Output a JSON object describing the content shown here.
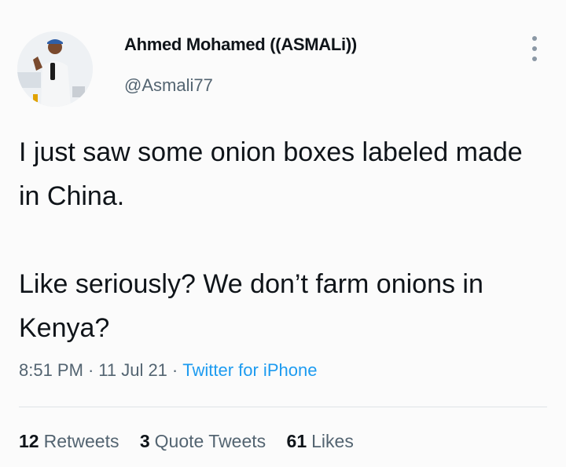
{
  "author": {
    "display_name": "Ahmed Mohamed ((ASMALi))",
    "handle": "@Asmali77"
  },
  "tweet": {
    "paragraph_1": "I just saw some onion boxes labeled made in China.",
    "paragraph_2": "Like seriously? We don’t farm onions in Kenya?"
  },
  "meta": {
    "time": "8:51 PM",
    "separator": "·",
    "date": "11 Jul 21",
    "source": "Twitter for iPhone"
  },
  "stats": {
    "retweets_count": "12",
    "retweets_label": "Retweets",
    "quote_count": "3",
    "quote_label": "Quote Tweets",
    "likes_count": "61",
    "likes_label": "Likes"
  },
  "colors": {
    "accent": "#1d9bf0",
    "text": "#0f1419",
    "secondary": "#536471"
  },
  "icons": {
    "more": "more-vertical-icon"
  }
}
